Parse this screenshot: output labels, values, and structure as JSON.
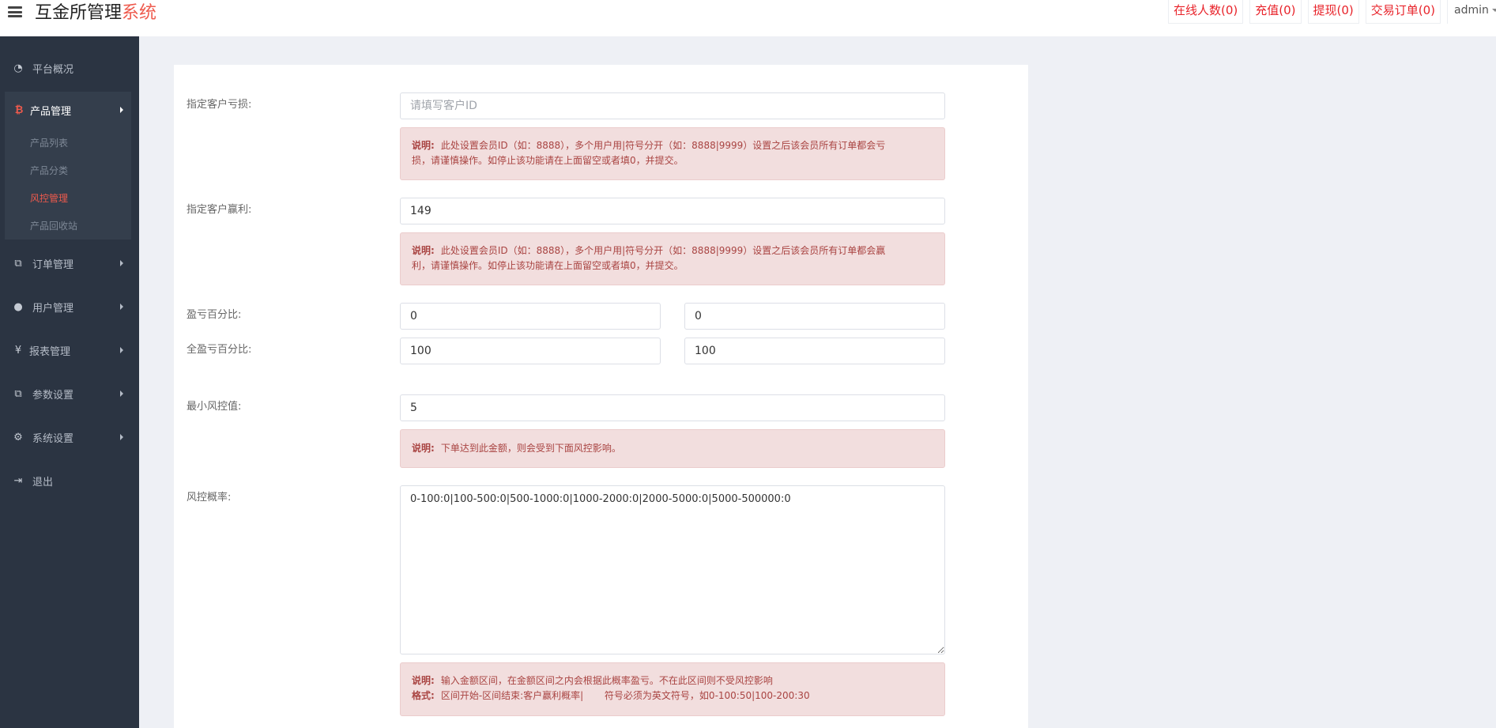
{
  "header": {
    "title_main": "互金所管理",
    "title_accent": "系统",
    "links": [
      "在线人数(0)",
      "充值(0)",
      "提现(0)",
      "交易订单(0)"
    ],
    "user": "admin"
  },
  "sidebar": {
    "overview": "平台概况",
    "product_mgmt": "产品管理",
    "sub_items": [
      "产品列表",
      "产品分类",
      "风控管理",
      "产品回收站"
    ],
    "order_mgmt": "订单管理",
    "user_mgmt": "用户管理",
    "report_mgmt": "报表管理",
    "param_settings": "参数设置",
    "system_settings": "系统设置",
    "logout": "退出"
  },
  "form": {
    "loss_label": "指定客户亏损:",
    "loss_placeholder": "请填写客户ID",
    "loss_note_title": "说明:",
    "loss_note_line1": "此处设置会员ID（如：8888），多个用户用|符号分开（如：8888|9999）设置之后该会员所有订单都会亏",
    "loss_note_line2": "损，请谨慎操作。如停止该功能请在上面留空或者填0，并提交。",
    "profit_label": "指定客户赢利:",
    "profit_value": "149",
    "profit_note_title": "说明:",
    "profit_note_line1": "此处设置会员ID（如：8888），多个用户用|符号分开（如：8888|9999）设置之后该会员所有订单都会赢",
    "profit_note_line2": "利，请谨慎操作。如停止该功能请在上面留空或者填0，并提交。",
    "pl_pct_label": "盈亏百分比:",
    "pl_pct_a": "0",
    "pl_pct_b": "0",
    "full_pl_pct_label": "全盈亏百分比:",
    "full_pl_pct_a": "100",
    "full_pl_pct_b": "100",
    "min_risk_label": "最小风控值:",
    "min_risk_value": "5",
    "min_risk_note_title": "说明:",
    "min_risk_note": "下单达到此金额，则会受到下面风控影响。",
    "prob_label": "风控概率:",
    "prob_value": "0-100:0|100-500:0|500-1000:0|1000-2000:0|2000-5000:0|5000-500000:0",
    "prob_note_title": "说明:",
    "prob_note": "输入金额区间，在金额区间之内会根据此概率盈亏。不在此区间则不受风控影响",
    "prob_format_title": "格式:",
    "prob_format": "区间开始-区间结束:客户赢利概率|       符号必须为英文符号，如0-100:50|100-200:30"
  }
}
